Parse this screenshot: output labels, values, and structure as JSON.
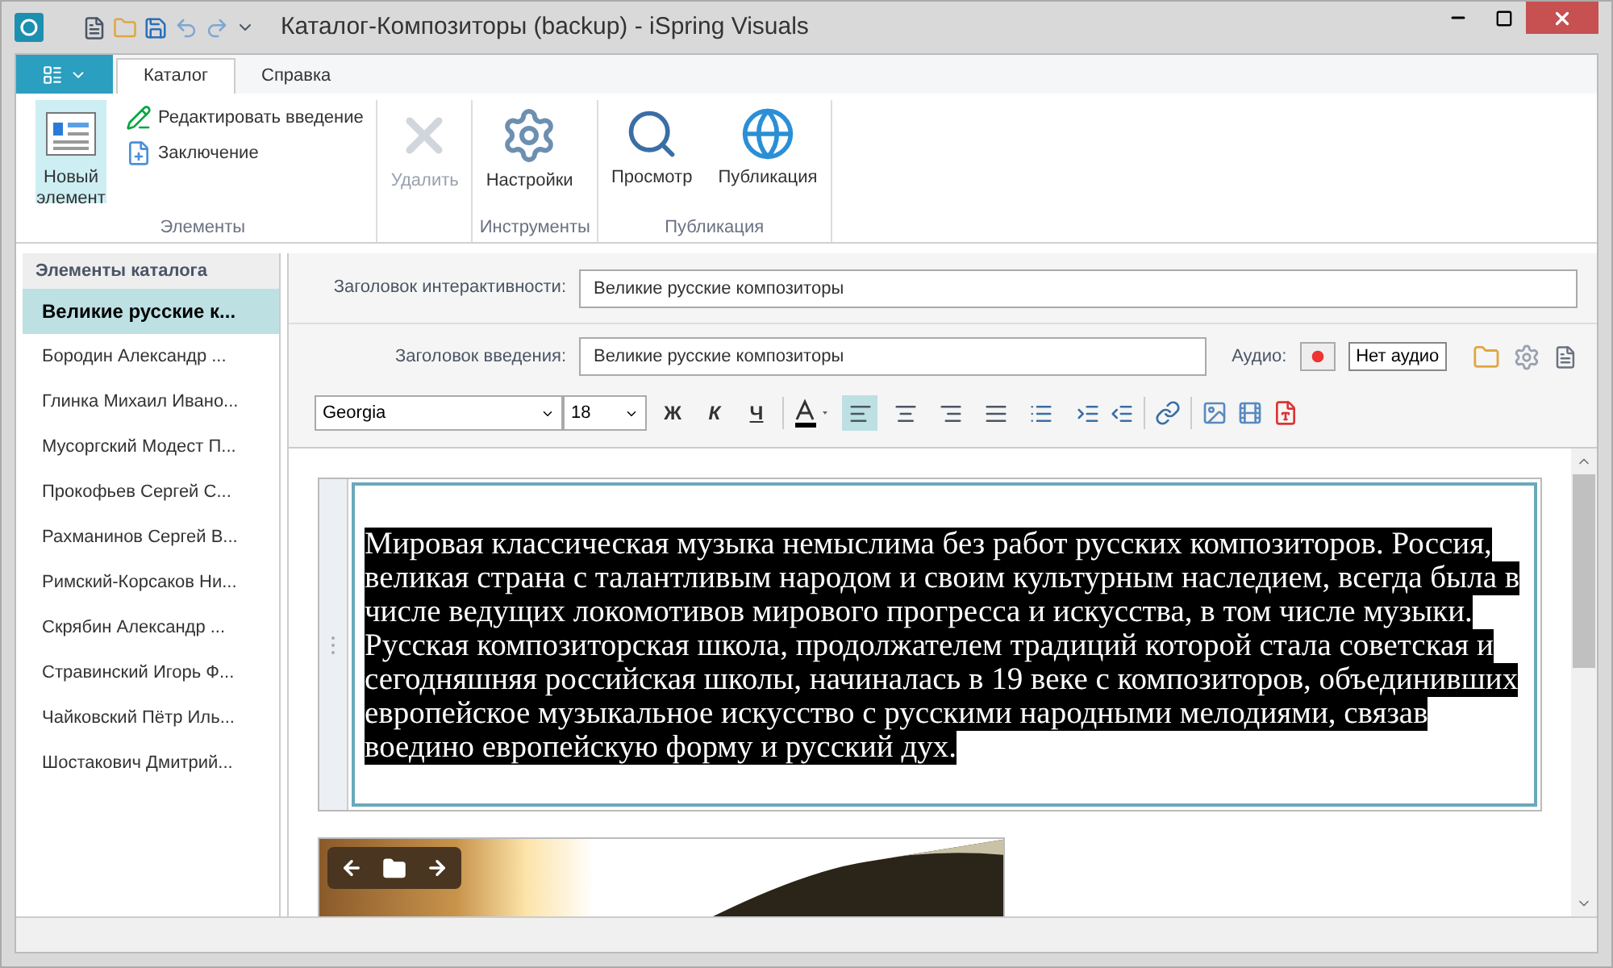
{
  "window": {
    "title": "Каталог-Композиторы (backup) - iSpring Visuals"
  },
  "ribbon": {
    "tabs": [
      {
        "label": "Каталог",
        "selected": true
      },
      {
        "label": "Справка",
        "selected": false
      }
    ],
    "groups": [
      {
        "label": "Элементы",
        "items": [
          {
            "label": "Новый элемент",
            "kind": "large",
            "disabled": false,
            "hovered": true
          },
          {
            "label": "Редактировать введение",
            "kind": "small",
            "disabled": false,
            "hovered": false
          },
          {
            "label": "Заключение",
            "kind": "small",
            "disabled": false,
            "hovered": false
          }
        ]
      },
      {
        "items": [
          {
            "label": "Удалить",
            "kind": "large",
            "disabled": true,
            "hovered": false
          }
        ]
      },
      {
        "label": "Инструменты",
        "items": [
          {
            "label": "Настройки",
            "kind": "large",
            "disabled": false,
            "hovered": false
          }
        ]
      },
      {
        "label": "Публикация",
        "items": [
          {
            "label": "Просмотр",
            "kind": "large",
            "disabled": false,
            "hovered": false
          },
          {
            "label": "Публикация",
            "kind": "large",
            "disabled": false,
            "hovered": false
          }
        ]
      }
    ]
  },
  "sidebar": {
    "title": "Элементы каталога",
    "items": [
      {
        "label": "Великие русские к...",
        "selected": true
      },
      {
        "label": "Бородин Александр ...",
        "selected": false
      },
      {
        "label": "Глинка Михаил Ивано...",
        "selected": false
      },
      {
        "label": "Мусоргский Модест П...",
        "selected": false
      },
      {
        "label": "Прокофьев Сергей С...",
        "selected": false
      },
      {
        "label": "Рахманинов Сергей В...",
        "selected": false
      },
      {
        "label": "Римский-Корсаков Ни...",
        "selected": false
      },
      {
        "label": "Скрябин Александр ...",
        "selected": false
      },
      {
        "label": "Стравинский Игорь Ф...",
        "selected": false
      },
      {
        "label": "Чайковский Пётр Иль...",
        "selected": false
      },
      {
        "label": "Шостакович Дмитрий...",
        "selected": false
      }
    ]
  },
  "form": {
    "interactivity_title": {
      "label": "Заголовок интерактивности:",
      "value": "Великие русские композиторы"
    },
    "intro_title": {
      "label": "Заголовок введения:",
      "value": "Великие русские композиторы"
    },
    "audio": {
      "label": "Аудио:",
      "status": "Нет аудио"
    }
  },
  "toolbar": {
    "font": "Georgia",
    "size": "18",
    "styles": [
      "Ж",
      "К",
      "Ч"
    ],
    "align": [
      {
        "selected": true
      },
      {
        "selected": false
      },
      {
        "selected": false
      },
      {
        "selected": false
      }
    ]
  },
  "content": {
    "paragraph": "Мировая классическая музыка немыслима без работ русских композиторов. Россия, великая страна с талантливым народом и своим культурным наследием, всегда была в числе ведущих локомотивов мирового прогресса и искусства, в том числе музыки. Русская композиторская школа, продолжателем традиций которой стала советская и сегодняшняя российская школы, начиналась в 19 веке с композиторов, объединивших европейское музыкальное искусство с русскими народными мелодиями, связав воедино европейскую форму и русский дух.",
    "selected": true
  }
}
